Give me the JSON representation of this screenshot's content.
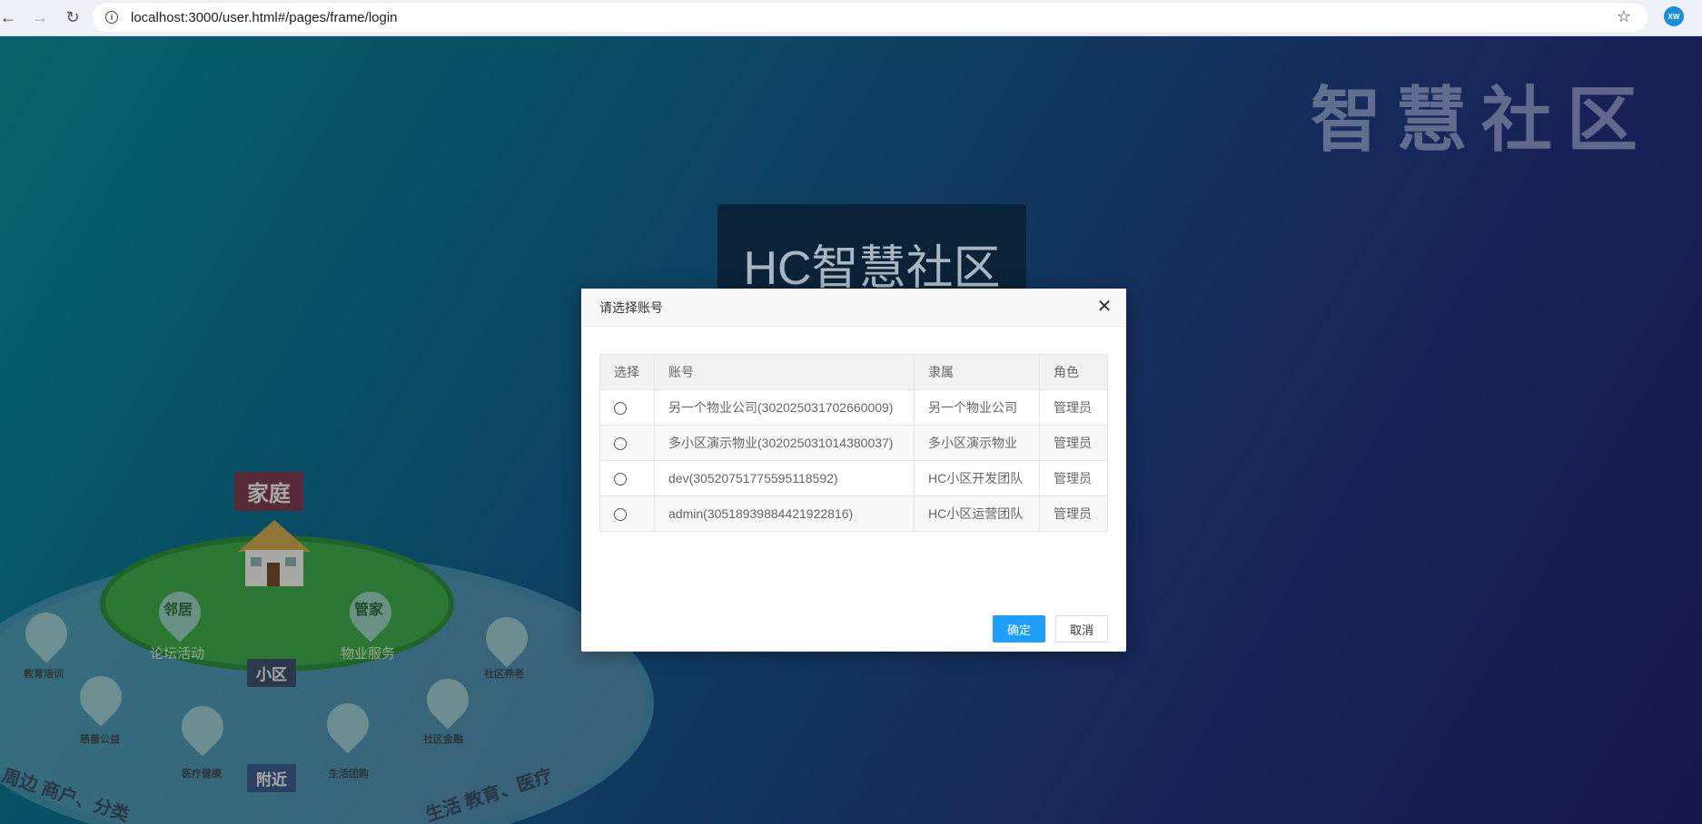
{
  "browser": {
    "url": "localhost:3000/user.html#/pages/frame/login",
    "avatar_initials": "XW"
  },
  "page": {
    "watermark": "智慧社区",
    "login_title": "HC智慧社区",
    "illustration": {
      "family_tag": "家庭",
      "neighbor": "邻居",
      "housekeeper": "管家",
      "forum": "论坛活动",
      "property_service": "物业服务",
      "community_tag": "小区",
      "nearby_tag": "附近",
      "education": "教育培训",
      "charity": "慈善公益",
      "medical": "医疗健康",
      "group_buy": "生活团购",
      "finance": "社区金融",
      "elderly": "社区养老",
      "arc_left": "周边 商户、分类",
      "arc_right": "生活 教育、医疗"
    }
  },
  "modal": {
    "title": "请选择账号",
    "columns": [
      "选择",
      "账号",
      "隶属",
      "角色"
    ],
    "rows": [
      {
        "account": "另一个物业公司(302025031702660009)",
        "owner": "另一个物业公司",
        "role": "管理员"
      },
      {
        "account": "多小区演示物业(302025031014380037)",
        "owner": "多小区演示物业",
        "role": "管理员"
      },
      {
        "account": "dev(30520751775595118592)",
        "owner": "HC小区开发团队",
        "role": "管理员"
      },
      {
        "account": "admin(30518939884421922816)",
        "owner": "HC小区运营团队",
        "role": "管理员"
      }
    ],
    "ok_label": "确定",
    "cancel_label": "取消"
  }
}
